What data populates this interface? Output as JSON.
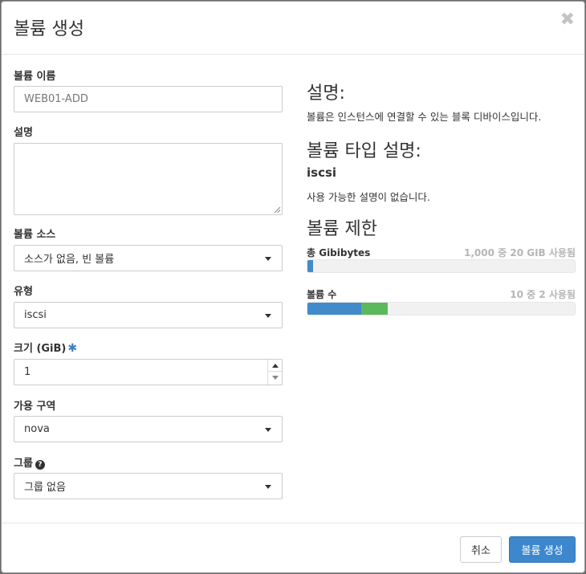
{
  "modal": {
    "title": "볼륨 생성",
    "close_glyph": "✖"
  },
  "form": {
    "name": {
      "label": "볼륨 이름",
      "placeholder": "WEB01-ADD",
      "value": ""
    },
    "description": {
      "label": "설명",
      "value": ""
    },
    "source": {
      "label": "볼륨 소스",
      "value": "소스가 없음, 빈 볼륨"
    },
    "type": {
      "label": "유형",
      "value": "iscsi"
    },
    "size": {
      "label": "크기 (GiB)",
      "required_mark": "✱",
      "value": "1"
    },
    "availability_zone": {
      "label": "가용 구역",
      "value": "nova"
    },
    "group": {
      "label": "그룹",
      "help_glyph": "?",
      "value": "그룹 없음"
    }
  },
  "info": {
    "desc_heading": "설명:",
    "desc_text": "볼륨은 인스턴스에 연결할 수 있는 블록 디바이스입니다.",
    "type_heading": "볼륨 타입 설명:",
    "type_name": "iscsi",
    "type_desc": "사용 가능한 설명이 없습니다.",
    "limits_heading": "볼륨 제한",
    "quotas": [
      {
        "label": "총 Gibibytes",
        "usage": "1,000 중 20 GIB 사용됨",
        "used_fraction": 0.02,
        "added_fraction": 0.0
      },
      {
        "label": "볼륨 수",
        "usage": "10 중 2 사용됨",
        "used_fraction": 0.2,
        "added_fraction": 0.1
      }
    ]
  },
  "footer": {
    "cancel_label": "취소",
    "create_label": "볼륨 생성"
  },
  "colors": {
    "primary": "#3d88cc",
    "bar_used": "#428bca",
    "bar_added": "#5cb85c",
    "required_star": "#3d7fc1"
  }
}
